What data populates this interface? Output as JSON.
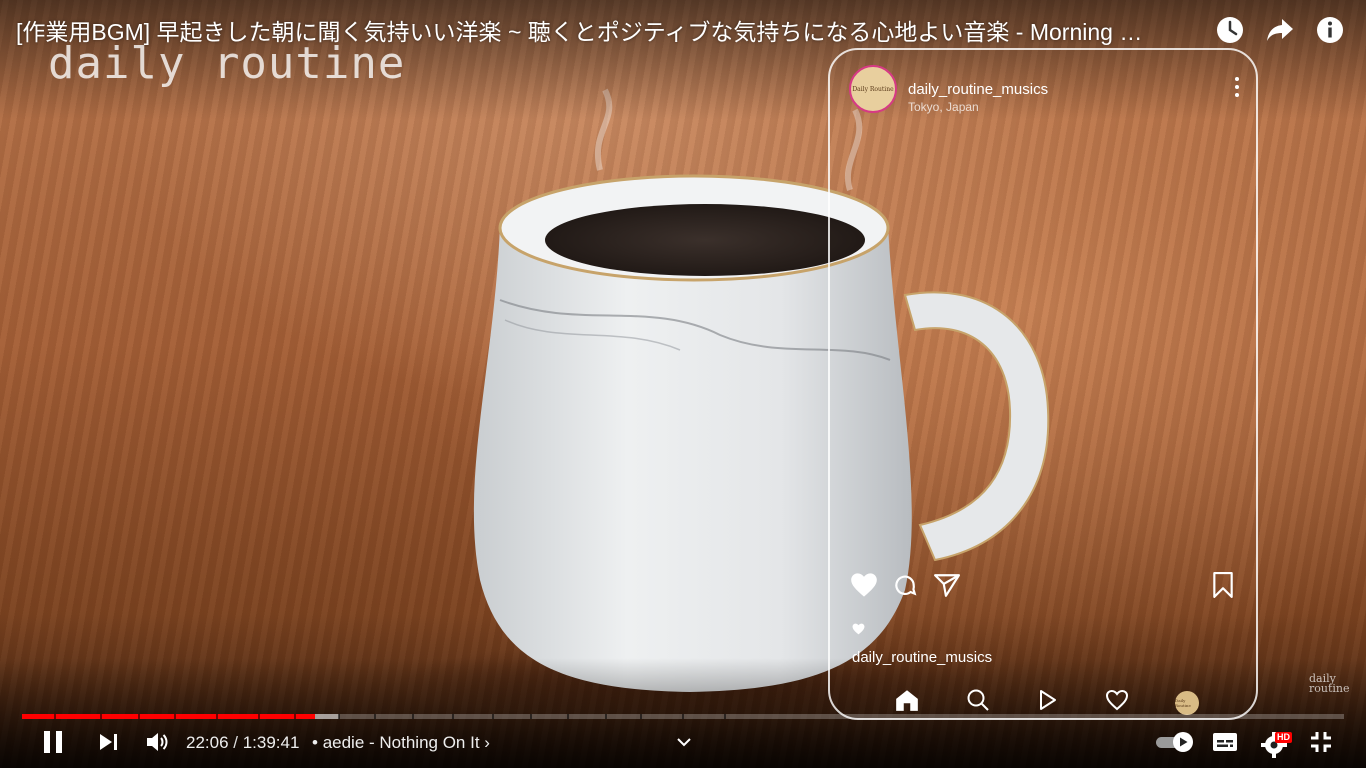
{
  "video": {
    "title": "[作業用BGM] 早起きした朝に聞く気持いい洋楽 ~ 聴くとポジティブな気持ちになる心地よい音楽 - Morning …",
    "watermark": "daily routine",
    "corner_logo_line1": "daily",
    "corner_logo_line2": "routine"
  },
  "top_actions": [
    {
      "name": "watch-later-icon",
      "label": "Watch later"
    },
    {
      "name": "share-icon",
      "label": "Share"
    },
    {
      "name": "info-icon",
      "label": "Info"
    }
  ],
  "instagram_overlay": {
    "username": "daily_routine_musics",
    "location": "Tokyo, Japan",
    "avatar_text": "Daily Routine",
    "caption_user": "daily_routine_musics",
    "icons": [
      "heart-icon",
      "comment-icon",
      "send-icon",
      "bookmark-icon"
    ],
    "nav_icons": [
      "home-icon",
      "search-icon",
      "reels-icon",
      "activity-heart-icon",
      "profile-avatar"
    ]
  },
  "player": {
    "current_time": "22:06",
    "separator": " / ",
    "duration": "1:39:41",
    "chapter_bullet": "•",
    "chapter_title": "aedie - Nothing On It",
    "chapter_chevron": "›",
    "played_fraction": 0.2217,
    "buffered_fraction": 0.24,
    "hd_badge": "HD",
    "autoplay": "on",
    "accent_color": "#ff0000"
  }
}
